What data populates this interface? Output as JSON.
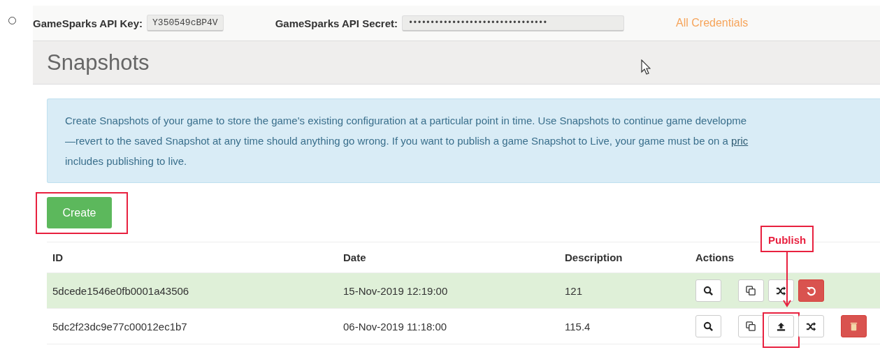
{
  "credentials": {
    "key_label": "GameSparks API Key:",
    "key_value": "Y350549cBP4V",
    "secret_label": "GameSparks API Secret:",
    "secret_value": "••••••••••••••••••••••••••••••••",
    "link": "All Credentials"
  },
  "panel": {
    "title": "Snapshots"
  },
  "info": {
    "lines": [
      "Create Snapshots of your game to store the game's existing configuration at a particular point in time. Use Snapshots to continue game developme",
      "—revert to the saved Snapshot at any time should anything go wrong. If you want to publish a game Snapshot to Live, your game must be on a ",
      "includes publishing to live."
    ],
    "link": "pric"
  },
  "create_button": "Create",
  "table": {
    "columns": [
      "ID",
      "Date",
      "Description",
      "Actions"
    ],
    "rows": [
      {
        "id": "5dcede1546e0fb0001a43506",
        "date": "15-Nov-2019 12:19:00",
        "description": "121",
        "highlighted": true,
        "actions": [
          {
            "kind": "search"
          },
          {
            "kind": "copy"
          },
          {
            "kind": "shuffle"
          },
          {
            "kind": "revert"
          }
        ]
      },
      {
        "id": "5dc2f23dc9e77c00012ec1b7",
        "date": "06-Nov-2019 11:18:00",
        "description": "115.4",
        "highlighted": false,
        "actions": [
          {
            "kind": "search"
          },
          {
            "kind": "copy"
          },
          {
            "kind": "publish"
          },
          {
            "kind": "shuffle"
          },
          {
            "kind": "delete"
          }
        ]
      }
    ]
  },
  "annotation": {
    "label": "Publish"
  }
}
